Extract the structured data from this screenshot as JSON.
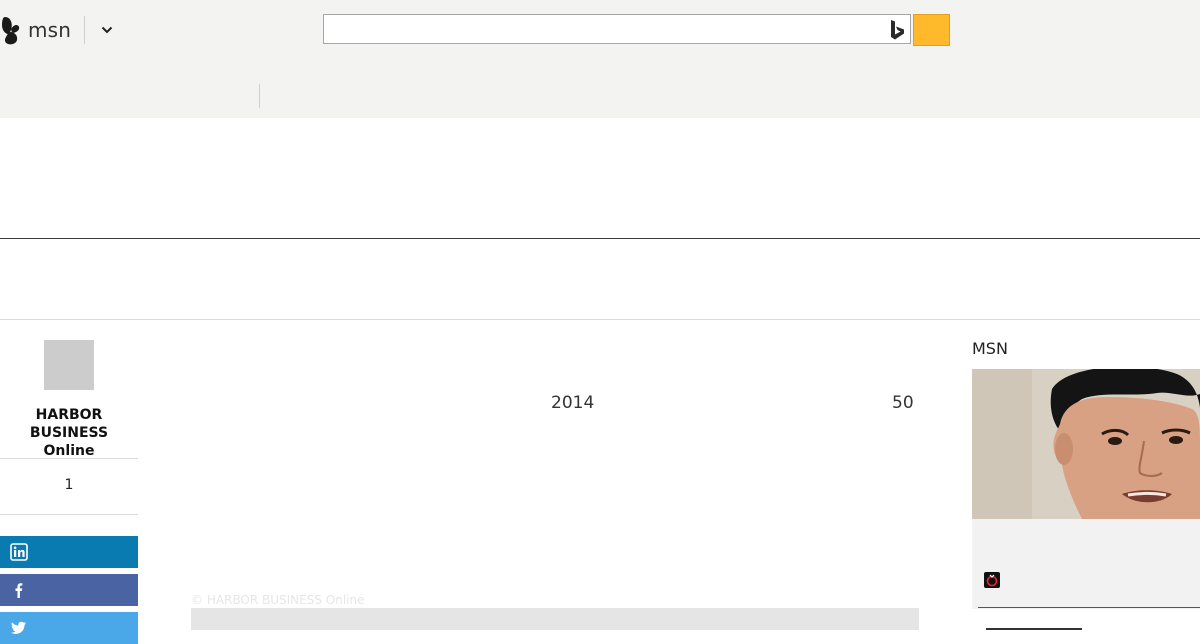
{
  "header": {
    "logo_text": "msn",
    "search": {
      "value": "",
      "placeholder": ""
    },
    "colors": {
      "header_bg": "#f3f3f2",
      "search_button": "#ffb92b"
    }
  },
  "article": {
    "publisher": {
      "name_line1": "HARBOR BUSINESS",
      "name_line2": "Online"
    },
    "comment_count": "1",
    "share": [
      {
        "network": "linkedin",
        "icon": "linkedin-icon",
        "color": "#0a7bb1"
      },
      {
        "network": "facebook",
        "icon": "facebook-icon",
        "color": "#4a63a3"
      },
      {
        "network": "twitter",
        "icon": "twitter-icon",
        "color": "#4aa7e8"
      }
    ],
    "body_fragments": {
      "year": "2014",
      "number": "50"
    },
    "photo_credit": "© HARBOR BUSINESS Online"
  },
  "sidebar": {
    "title": "MSN",
    "source_icon": "source-logo-icon"
  }
}
